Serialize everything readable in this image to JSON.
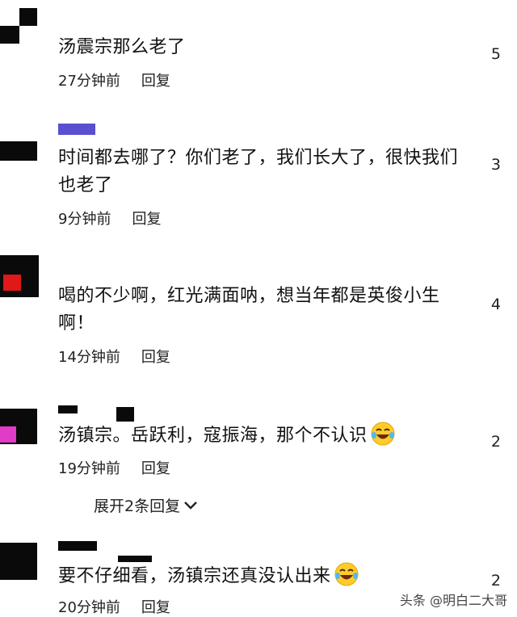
{
  "comments": [
    {
      "text": "汤震宗那么老了",
      "time": "27分钟前",
      "reply": "回复",
      "likes": "5"
    },
    {
      "text": "时间都去哪了？你们老了，我们长大了，很快我们也老了",
      "time": "9分钟前",
      "reply": "回复",
      "likes": "3"
    },
    {
      "text": "喝的不少啊，红光满面呐，想当年都是英俊小生啊！",
      "time": "14分钟前",
      "reply": "回复",
      "likes": "4"
    },
    {
      "text": "汤镇宗。岳跃利，寇振海，那个不认识",
      "time": "19分钟前",
      "reply": "回复",
      "likes": "2",
      "expand": "展开2条回复"
    },
    {
      "text": "要不仔细看，汤镇宗还真没认出来",
      "time": "20分钟前",
      "reply": "回复",
      "likes": "2"
    }
  ],
  "icons": {
    "laugh": "laughing-tears-emoji",
    "chevron": "chevron-down-icon"
  },
  "watermark": "头条 @明白二大哥"
}
